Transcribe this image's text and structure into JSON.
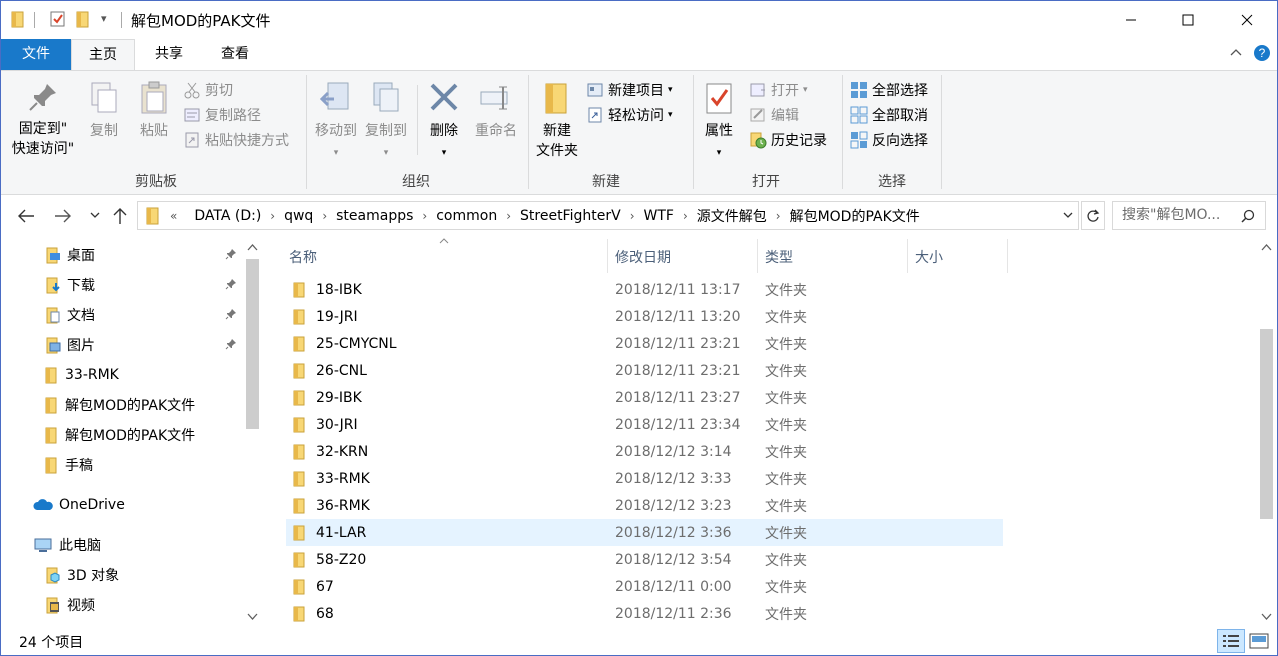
{
  "window": {
    "title": "解包MOD的PAK文件",
    "qa_dropdown": "▾"
  },
  "tabs": {
    "file": "文件",
    "home": "主页",
    "share": "共享",
    "view": "查看"
  },
  "ribbon": {
    "clipboard": {
      "pin_quick_access_line1": "固定到\"",
      "pin_quick_access_line2": "快速访问\"",
      "copy": "复制",
      "paste": "粘贴",
      "cut": "剪切",
      "copy_path": "复制路径",
      "paste_shortcut": "粘贴快捷方式",
      "label": "剪贴板"
    },
    "organize": {
      "move_to": "移动到",
      "copy_to": "复制到",
      "delete": "删除",
      "rename": "重命名",
      "label": "组织"
    },
    "new": {
      "new_folder_line1": "新建",
      "new_folder_line2": "文件夹",
      "new_item": "新建项目",
      "easy_access": "轻松访问",
      "label": "新建"
    },
    "open": {
      "properties": "属性",
      "open": "打开",
      "edit": "编辑",
      "history": "历史记录",
      "label": "打开"
    },
    "select": {
      "select_all": "全部选择",
      "select_none": "全部取消",
      "invert": "反向选择",
      "label": "选择"
    }
  },
  "address": {
    "overflow": "«",
    "crumbs": [
      "DATA (D:)",
      "qwq",
      "steamapps",
      "common",
      "StreetFighterV",
      "WTF",
      "源文件解包",
      "解包MOD的PAK文件"
    ],
    "search_placeholder": "搜索\"解包MO..."
  },
  "nav": {
    "items": [
      {
        "label": "桌面",
        "icon": "desktop-icon",
        "pinned": true
      },
      {
        "label": "下载",
        "icon": "download-icon",
        "pinned": true
      },
      {
        "label": "文档",
        "icon": "documents-icon",
        "pinned": true
      },
      {
        "label": "图片",
        "icon": "pictures-icon",
        "pinned": true
      },
      {
        "label": "33-RMK",
        "icon": "folder-icon",
        "pinned": false
      },
      {
        "label": "解包MOD的PAK文件",
        "icon": "folder-icon",
        "pinned": false
      },
      {
        "label": "解包MOD的PAK文件",
        "icon": "folder-icon",
        "pinned": false
      },
      {
        "label": "手稿",
        "icon": "folder-icon",
        "pinned": false
      },
      {
        "label": "OneDrive",
        "icon": "onedrive-icon",
        "pinned": false
      },
      {
        "label": "此电脑",
        "icon": "this-pc-icon",
        "pinned": false
      },
      {
        "label": "3D 对象",
        "icon": "3d-objects-icon",
        "pinned": false
      },
      {
        "label": "视频",
        "icon": "videos-icon",
        "pinned": false
      }
    ]
  },
  "columns": {
    "name": "名称",
    "date": "修改日期",
    "type": "类型",
    "size": "大小"
  },
  "files": [
    {
      "name": "18-IBK",
      "date": "2018/12/11 13:17",
      "type": "文件夹"
    },
    {
      "name": "19-JRI",
      "date": "2018/12/11 13:20",
      "type": "文件夹"
    },
    {
      "name": "25-CMYCNL",
      "date": "2018/12/11 23:21",
      "type": "文件夹"
    },
    {
      "name": "26-CNL",
      "date": "2018/12/11 23:21",
      "type": "文件夹"
    },
    {
      "name": "29-IBK",
      "date": "2018/12/11 23:27",
      "type": "文件夹"
    },
    {
      "name": "30-JRI",
      "date": "2018/12/11 23:34",
      "type": "文件夹"
    },
    {
      "name": "32-KRN",
      "date": "2018/12/12 3:14",
      "type": "文件夹"
    },
    {
      "name": "33-RMK",
      "date": "2018/12/12 3:33",
      "type": "文件夹"
    },
    {
      "name": "36-RMK",
      "date": "2018/12/12 3:23",
      "type": "文件夹"
    },
    {
      "name": "41-LAR",
      "date": "2018/12/12 3:36",
      "type": "文件夹",
      "selected": true
    },
    {
      "name": "58-Z20",
      "date": "2018/12/12 3:54",
      "type": "文件夹"
    },
    {
      "name": "67",
      "date": "2018/12/11 0:00",
      "type": "文件夹"
    },
    {
      "name": "68",
      "date": "2018/12/11 2:36",
      "type": "文件夹"
    }
  ],
  "status": {
    "item_count": "24 个项目"
  },
  "colors": {
    "accent": "#1979ca",
    "selection": "#e5f3ff",
    "folder": "#f8d775"
  }
}
